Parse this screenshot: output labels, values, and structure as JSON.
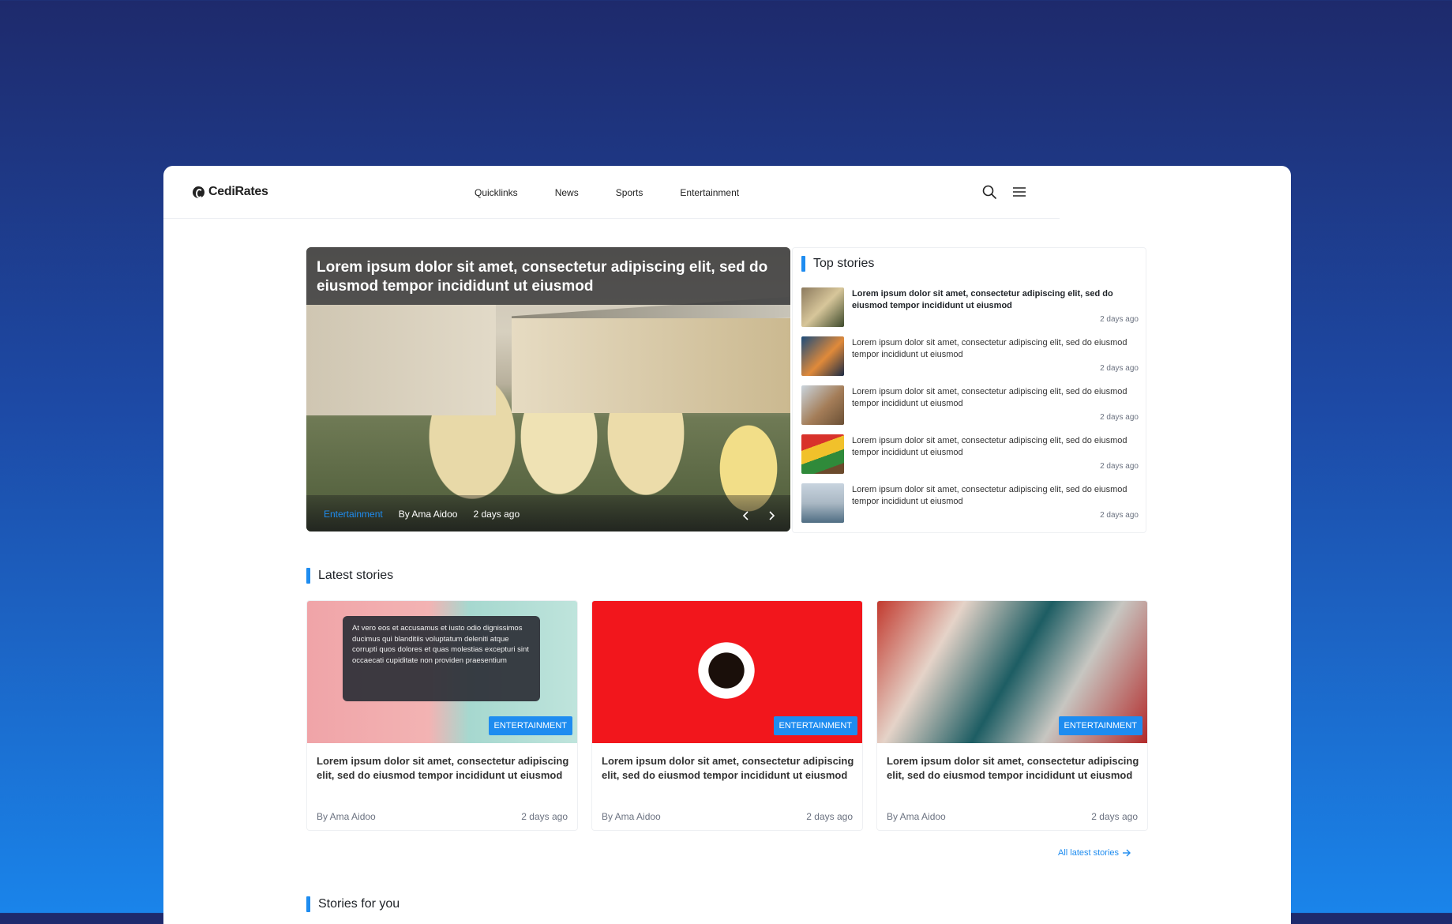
{
  "brand": {
    "name": "CediRates"
  },
  "nav": {
    "links": [
      "Quicklinks",
      "News",
      "Sports",
      "Entertainment"
    ],
    "icons": [
      "search-icon",
      "menu-icon"
    ]
  },
  "hero": {
    "title": "Lorem ipsum dolor sit amet, consectetur adipiscing elit, sed do eiusmod tempor incididunt ut eiusmod",
    "category": "Entertainment",
    "author": "By Ama Aidoo",
    "time": "2 days ago"
  },
  "top_stories": {
    "heading": "Top stories",
    "items": [
      {
        "text": "Lorem ipsum dolor sit amet, consectetur adipiscing elit, sed do eiusmod tempor incididunt ut eiusmod",
        "time": "2 days ago"
      },
      {
        "text": "Lorem ipsum dolor sit amet, consectetur adipiscing elit, sed do eiusmod tempor incididunt ut eiusmod",
        "time": "2 days ago"
      },
      {
        "text": "Lorem ipsum dolor sit amet, consectetur adipiscing elit, sed do eiusmod tempor incididunt ut eiusmod",
        "time": "2 days ago"
      },
      {
        "text": "Lorem ipsum dolor sit amet, consectetur adipiscing elit, sed do eiusmod tempor incididunt ut eiusmod",
        "time": "2 days ago"
      },
      {
        "text": "Lorem ipsum dolor sit amet, consectetur adipiscing elit, sed do eiusmod tempor incididunt ut eiusmod",
        "time": "2 days ago"
      }
    ]
  },
  "latest": {
    "heading": "Latest stories",
    "tooltip": "At vero eos et accusamus et iusto odio dignissimos ducimus qui blanditiis voluptatum deleniti atque corrupti quos dolores et quas molestias excepturi sint occaecati cupiditate non providen praesentium",
    "cards": [
      {
        "badge": "ENTERTAINMENT",
        "title": "Lorem ipsum dolor sit amet, consectetur adipiscing elit, sed do eiusmod tempor incididunt ut eiusmod",
        "author": "By Ama Aidoo",
        "time": "2 days ago"
      },
      {
        "badge": "ENTERTAINMENT",
        "title": "Lorem ipsum dolor sit amet, consectetur adipiscing elit, sed do eiusmod tempor incididunt ut eiusmod",
        "author": "By Ama Aidoo",
        "time": "2 days ago"
      },
      {
        "badge": "ENTERTAINMENT",
        "title": "Lorem ipsum dolor sit amet, consectetur adipiscing elit, sed do eiusmod tempor incididunt ut eiusmod",
        "author": "By Ama Aidoo",
        "time": "2 days ago"
      }
    ],
    "all_link": "All latest stories"
  },
  "stories_for_you": {
    "heading": "Stories for you"
  },
  "colors": {
    "accent": "#1e8cf0",
    "background_top": "#1e2a6c",
    "background_bottom": "#1a84ea"
  }
}
